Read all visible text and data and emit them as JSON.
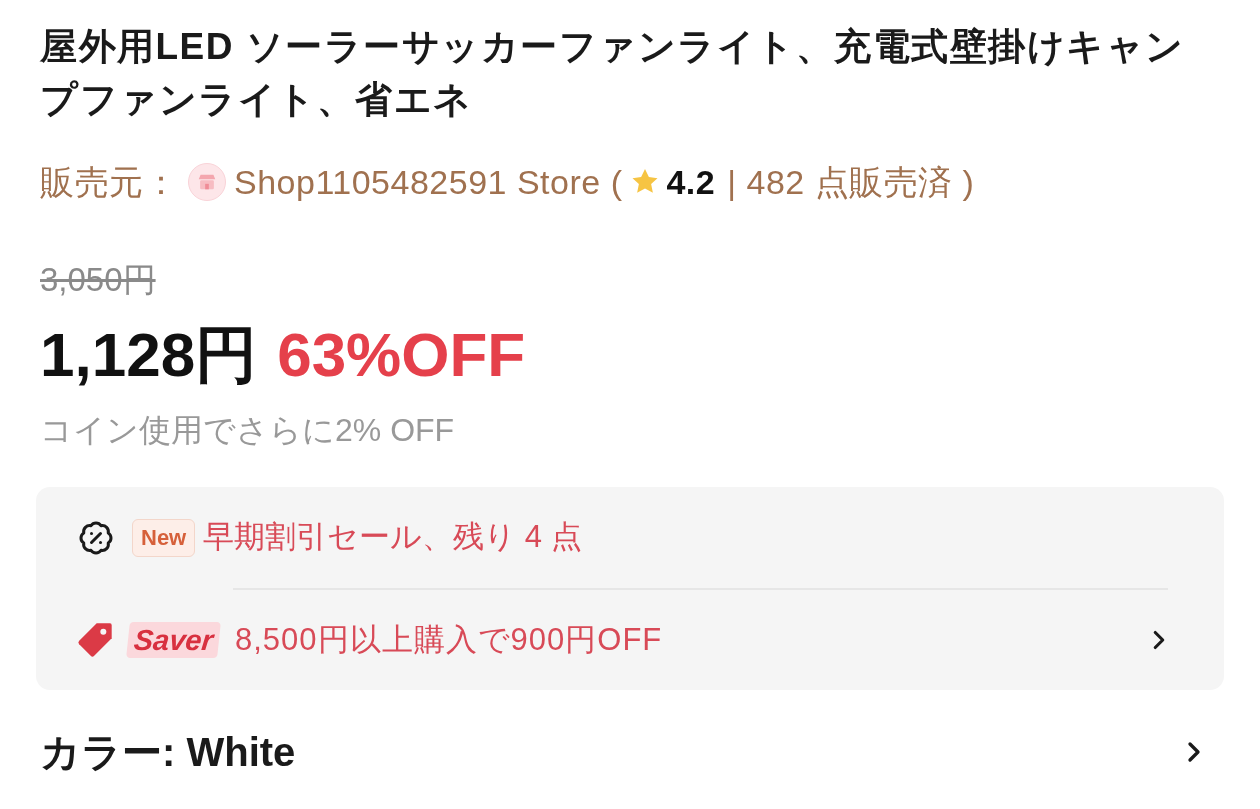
{
  "title": "屋外用LED ソーラーサッカーファンライト、充電式壁掛けキャンプファンライト、省エネ",
  "seller": {
    "label": "販売元：",
    "store": "Shop1105482591 Store (",
    "rating": "4.2",
    "sold": "| 482 点販売済 )"
  },
  "pricing": {
    "original_price": "3,050円",
    "price": "1,128円",
    "discount": "63%OFF",
    "coin_note": "コイン使用でさらに2% OFF"
  },
  "promotions": [
    {
      "kind": "flash",
      "badge": "New",
      "text": "早期割引セール、残り 4 点"
    },
    {
      "kind": "saver",
      "logo": "Saver",
      "text": "8,500円以上購入で900円OFF"
    }
  ],
  "variant": {
    "label": "カラー:",
    "value": "White"
  }
}
